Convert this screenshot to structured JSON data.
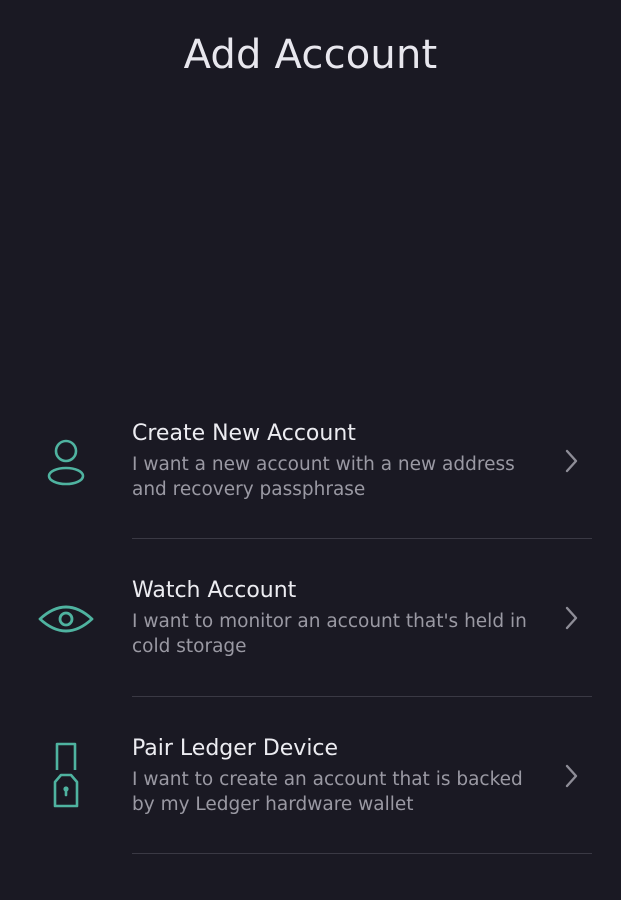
{
  "header": {
    "title": "Add Account"
  },
  "options": [
    {
      "title": "Create New Account",
      "description": "I want a new account with a new address and recovery passphrase",
      "icon": "person-icon"
    },
    {
      "title": "Watch Account",
      "description": "I want to monitor an account that's held in cold storage",
      "icon": "eye-icon"
    },
    {
      "title": "Pair Ledger Device",
      "description": "I want to create an account that is backed by my Ledger hardware wallet",
      "icon": "ledger-device-icon"
    }
  ],
  "colors": {
    "background": "#1a1923",
    "accent": "#4fb3a0",
    "title_text": "#ececf1",
    "description_text": "#9a99a3",
    "chevron": "#8e8d97",
    "divider": "#3a3944"
  }
}
